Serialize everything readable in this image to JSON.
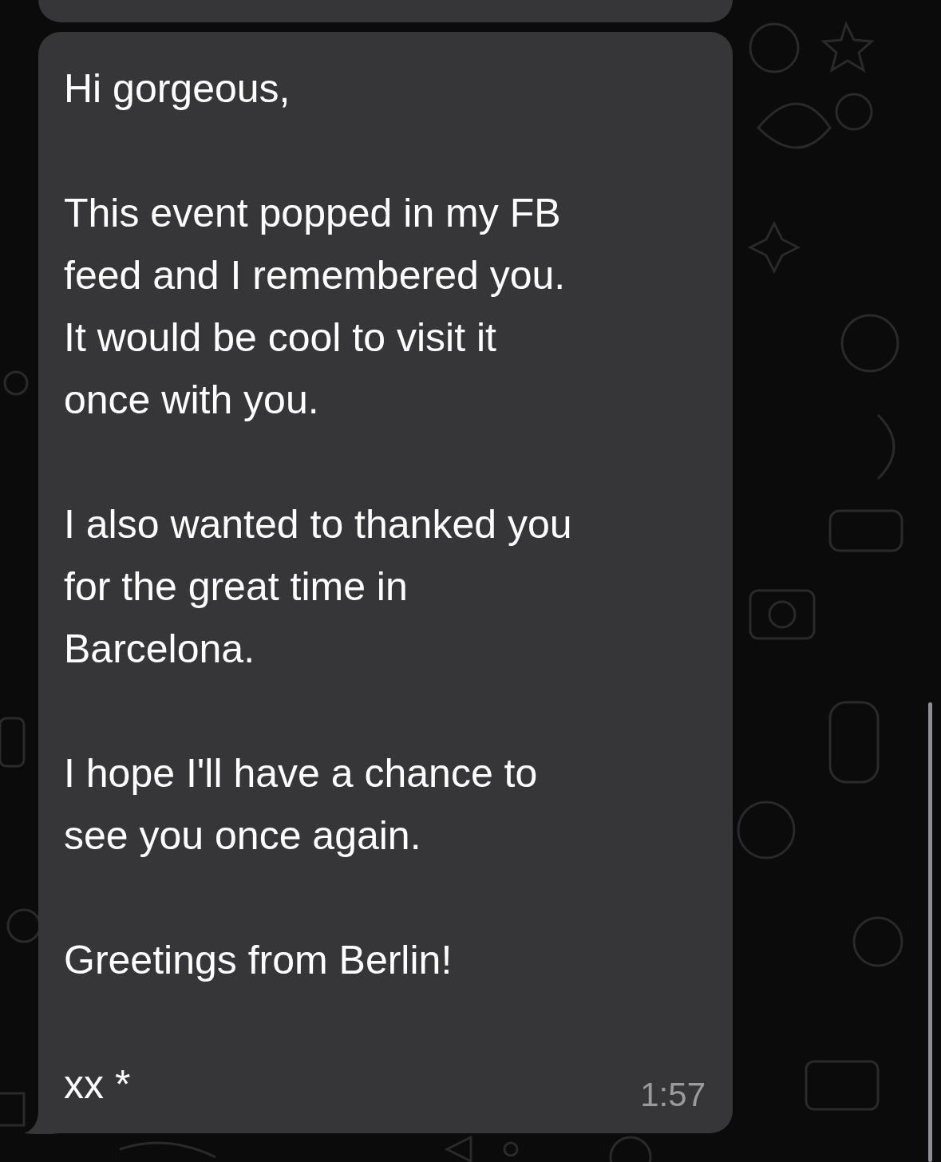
{
  "message": {
    "paragraphs": [
      {
        "lines": [
          "Hi gorgeous,"
        ]
      },
      {
        "lines": [
          "This event popped in my FB",
          "feed and I remembered you.",
          "It would be cool to visit it",
          "once with you."
        ]
      },
      {
        "lines": [
          "I also wanted to thanked you",
          "for the great time in",
          "Barcelona."
        ]
      },
      {
        "lines": [
          "I hope I'll have a chance to",
          "see you once again."
        ]
      },
      {
        "lines": [
          "Greetings from Berlin!"
        ]
      },
      {
        "lines": [
          "xx *"
        ]
      }
    ],
    "time": "1:57"
  }
}
